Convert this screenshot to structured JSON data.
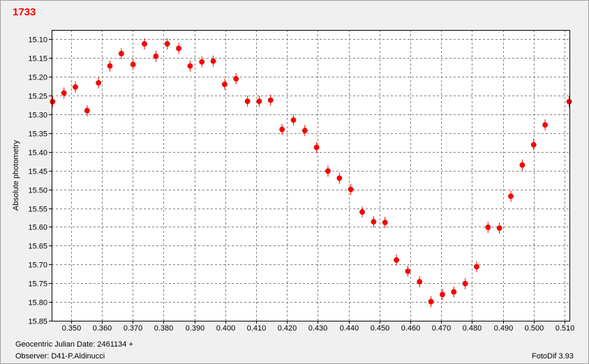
{
  "title": "1733",
  "footer": {
    "date_label": "Geocentric Julian Date: 2461134 +",
    "observer_label": "Observer: D41-P.Aldinucci",
    "software": "FotoDif 3.93"
  },
  "colors": {
    "accent": "#ff0000",
    "marker": "#ff0000",
    "grid": "#808080",
    "background": "#f0f0f0",
    "plot_background": "#ffffff"
  },
  "chart_data": {
    "type": "scatter",
    "title": "1733",
    "xlabel": "Geocentric Julian Date: 2461134 +",
    "ylabel": "Absolute photometry",
    "xlim": [
      0.3437,
      0.5116
    ],
    "ylim": [
      15.85,
      15.075
    ],
    "y_inverted": true,
    "grid": true,
    "x_ticks": [
      0.35,
      0.36,
      0.37,
      0.38,
      0.39,
      0.4,
      0.41,
      0.42,
      0.43,
      0.44,
      0.45,
      0.46,
      0.47,
      0.48,
      0.49,
      0.5,
      0.51
    ],
    "x_tick_labels": [
      "0.350",
      "0.360",
      "0.370",
      "0.380",
      "0.390",
      "0.400",
      "0.410",
      "0.420",
      "0.430",
      "0.440",
      "0.450",
      "0.460",
      "0.470",
      "0.480",
      "0.490",
      "0.500",
      "0.510"
    ],
    "y_ticks": [
      15.1,
      15.15,
      15.2,
      15.25,
      15.3,
      15.35,
      15.4,
      15.45,
      15.5,
      15.55,
      15.6,
      15.65,
      15.7,
      15.75,
      15.8,
      15.85
    ],
    "y_tick_labels": [
      "15.10",
      "15.15",
      "15.20",
      "15.25",
      "15.30",
      "15.35",
      "15.40",
      "15.45",
      "15.50",
      "15.55",
      "15.60",
      "15.65",
      "15.70",
      "15.75",
      "15.80",
      "15.85"
    ],
    "series": [
      {
        "error": 0.015,
        "points": [
          [
            0.344,
            15.266
          ],
          [
            0.3477,
            15.243
          ],
          [
            0.3514,
            15.227
          ],
          [
            0.3552,
            15.29
          ],
          [
            0.3589,
            15.216
          ],
          [
            0.3626,
            15.171
          ],
          [
            0.3663,
            15.138
          ],
          [
            0.3701,
            15.167
          ],
          [
            0.3738,
            15.112
          ],
          [
            0.3775,
            15.145
          ],
          [
            0.3812,
            15.112
          ],
          [
            0.3849,
            15.124
          ],
          [
            0.3886,
            15.171
          ],
          [
            0.3924,
            15.16
          ],
          [
            0.3961,
            15.158
          ],
          [
            0.3998,
            15.22
          ],
          [
            0.4035,
            15.205
          ],
          [
            0.4072,
            15.265
          ],
          [
            0.411,
            15.265
          ],
          [
            0.4147,
            15.262
          ],
          [
            0.4184,
            15.34
          ],
          [
            0.4221,
            15.315
          ],
          [
            0.4258,
            15.343
          ],
          [
            0.4296,
            15.388
          ],
          [
            0.4333,
            15.451
          ],
          [
            0.437,
            15.47
          ],
          [
            0.4407,
            15.5
          ],
          [
            0.4444,
            15.56
          ],
          [
            0.4481,
            15.586
          ],
          [
            0.4518,
            15.588
          ],
          [
            0.4555,
            15.688
          ],
          [
            0.4592,
            15.718
          ],
          [
            0.463,
            15.746
          ],
          [
            0.4667,
            15.799
          ],
          [
            0.4704,
            15.78
          ],
          [
            0.4741,
            15.773
          ],
          [
            0.4778,
            15.751
          ],
          [
            0.4815,
            15.706
          ],
          [
            0.4852,
            15.601
          ],
          [
            0.4889,
            15.603
          ],
          [
            0.4926,
            15.518
          ],
          [
            0.4963,
            15.435
          ],
          [
            0.5,
            15.381
          ],
          [
            0.5037,
            15.328
          ],
          [
            0.5115,
            15.266
          ]
        ]
      }
    ]
  }
}
